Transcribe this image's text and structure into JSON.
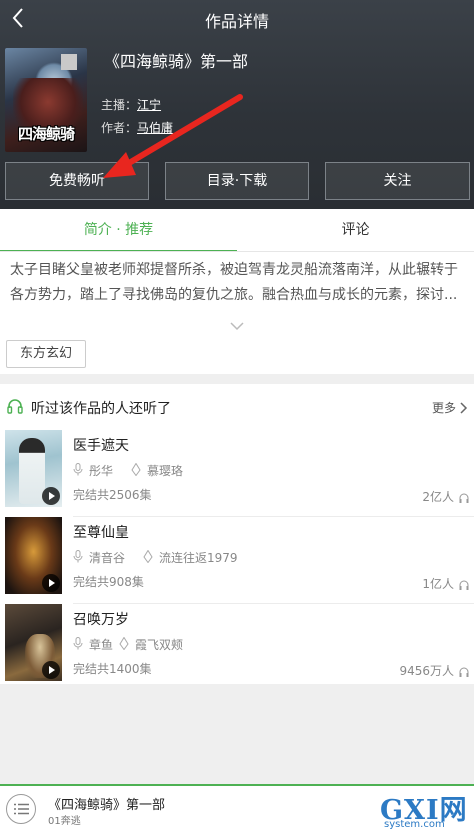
{
  "header": {
    "title": "作品详情",
    "back_icon": "back-arrow-icon"
  },
  "book": {
    "name": "《四海鲸骑》第一部",
    "cover_title": "四海鲸骑",
    "narrator_label": "主播：",
    "narrator": "江宁",
    "author_label": "作者：",
    "author": "马伯庸"
  },
  "actions": {
    "listen": "免费畅听",
    "catalog": "目录·下载",
    "follow": "关注"
  },
  "tabs": {
    "intro": "简介 · 推荐",
    "comments": "评论"
  },
  "intro": {
    "text": "太子目睹父皇被老师郑提督所杀，被迫驾青龙灵船流落南洋，从此辗转于各方势力，踏上了寻找佛岛的复仇之旅。融合热血与成长的元素，探讨...",
    "tag": "东方玄幻"
  },
  "recommend": {
    "title": "听过该作品的人还听了",
    "more": "更多",
    "items": [
      {
        "name": "医手遮天",
        "narrator": "彤华",
        "author": "慕璎珞",
        "episodes": "完结共2506集",
        "plays": "2亿人"
      },
      {
        "name": "至尊仙皇",
        "narrator": "清音谷",
        "author": "流连往返1979",
        "episodes": "完结共908集",
        "plays": "1亿人"
      },
      {
        "name": "召唤万岁",
        "narrator": "章鱼",
        "author": "霞飞双颊",
        "episodes": "完结共1400集",
        "plays": "9456万人"
      }
    ]
  },
  "player": {
    "title": "《四海鲸骑》第一部",
    "subtitle": "01奔逃"
  },
  "watermark": {
    "brand": "GXI网",
    "site": "system.com"
  },
  "colors": {
    "accent": "#4db153",
    "annotation_arrow": "#e8261f",
    "header_bg": "#2e3339"
  }
}
